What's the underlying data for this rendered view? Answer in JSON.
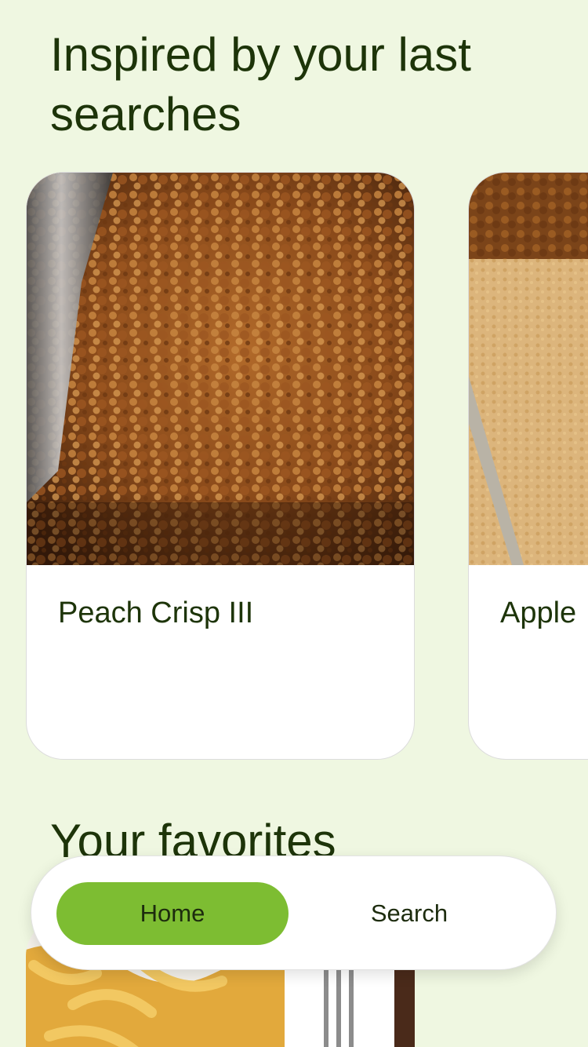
{
  "sections": {
    "inspired_title": "Inspired by your last searches",
    "favorites_title": "Your favorites"
  },
  "recipes": [
    {
      "title": "Peach Crisp III"
    },
    {
      "title": "Apple"
    }
  ],
  "nav": {
    "home_label": "Home",
    "search_label": "Search",
    "active": "Home"
  },
  "colors": {
    "background": "#eff7e1",
    "accent": "#7dbd32",
    "text": "#1d3409",
    "surface": "#ffffff"
  }
}
